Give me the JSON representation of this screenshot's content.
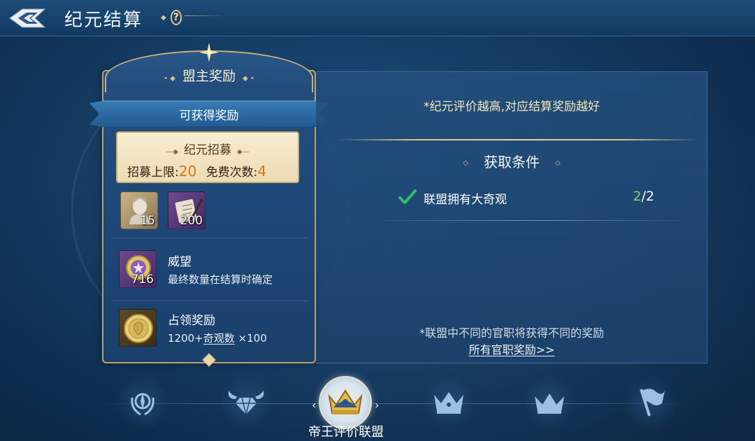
{
  "header": {
    "title": "纪元结算",
    "help_label": "?"
  },
  "left_panel": {
    "title": "盟主奖励",
    "ribbon": "可获得奖励",
    "recruit": {
      "title": "纪元招募",
      "limit_label": "招募上限:",
      "limit_value": "20",
      "free_label": "免费次数:",
      "free_value": "4"
    },
    "items": [
      {
        "icon": "bust-statue-icon",
        "count": "15"
      },
      {
        "icon": "scroll-quill-icon",
        "count": "200"
      }
    ],
    "prestige": {
      "icon": "prestige-medal-icon",
      "count": "716",
      "name": "威望",
      "desc": "最终数量在结算时确定"
    },
    "occupation": {
      "icon": "gold-coin-icon",
      "name": "占领奖励",
      "desc_prefix": "1200+",
      "desc_link": "奇观数",
      "desc_suffix": " ×100"
    }
  },
  "right_panel": {
    "rating_note": "*纪元评价越高,对应结算奖励越好",
    "conditions_title": "获取条件",
    "conditions": [
      {
        "text": "联盟拥有大奇观",
        "current": "2",
        "total": "/2",
        "done": true
      }
    ],
    "bottom_note": "*联盟中不同的官职将获得不同的奖励",
    "all_rewards_link": "所有官职奖励>>"
  },
  "tabs": [
    {
      "name": "compass-laurel",
      "active": false
    },
    {
      "name": "winged-diamond",
      "active": false
    },
    {
      "name": "emperor-crown",
      "active": true
    },
    {
      "name": "crown-ornate",
      "active": false
    },
    {
      "name": "crown-simple",
      "active": false
    },
    {
      "name": "flag",
      "active": false
    }
  ],
  "active_tab_label": "帝王评价联盟",
  "colors": {
    "gold": "#d8c17e",
    "accent_orange": "#d8741c",
    "check_green": "#2fbf6a",
    "progress_green": "#7ed36c"
  }
}
